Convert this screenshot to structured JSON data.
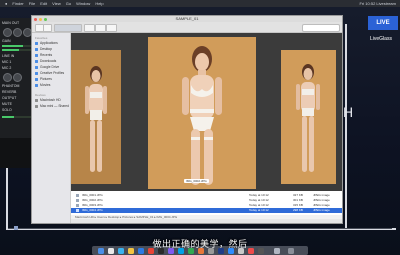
{
  "menubar": {
    "items": [
      "Finder",
      "File",
      "Edit",
      "View",
      "Go",
      "Window",
      "Help"
    ],
    "right_text": "Fri 10:52  Livestream"
  },
  "logo": {
    "text": "LIVE",
    "caption": "LiveGlass"
  },
  "side_glyph": "H",
  "panel": {
    "rows": [
      "MAIN OUT",
      "GAIN",
      "LINE IN",
      "MIC 1",
      "MIC 2",
      "PHANTOM",
      "REVERB",
      "OUTPUT",
      "MUTE",
      "SOLO"
    ]
  },
  "finder": {
    "title": "SAMPLE_01",
    "sidebar": {
      "favorites_label": "Favorites",
      "items": [
        "Applications",
        "Desktop",
        "Recents",
        "Downloads",
        "Google Drive",
        "Creative Profiles",
        "Pictures",
        "Movies"
      ],
      "devices_label": "Devices",
      "devices": [
        "Macintosh HD",
        "Mac mini — Shared"
      ]
    },
    "preview_caption": "IMG_0002.JPG",
    "files": [
      {
        "name": "IMG_0001.JPG",
        "date": "Today at 10:12",
        "size": "327 KB",
        "kind": "JPEG image",
        "selected": false
      },
      {
        "name": "IMG_0002.JPG",
        "date": "Today at 10:12",
        "size": "301 KB",
        "kind": "JPEG image",
        "selected": false
      },
      {
        "name": "IMG_0003.JPG",
        "date": "Today at 10:12",
        "size": "315 KB",
        "kind": "JPEG image",
        "selected": false
      },
      {
        "name": "IMG_0004.JPG",
        "date": "Today at 10:12",
        "size": "298 KB",
        "kind": "JPEG image",
        "selected": true
      }
    ],
    "path": "Macintosh HD ▸ Users ▸ Desktop ▸ Pictures ▸ SAMPLE_01 ▸ IMG_0004.JPG"
  },
  "subtitle": "做出正确的美学，然后",
  "colors": {
    "accent": "#2f6bd8",
    "backdrop": "#d19c5a",
    "desktop": "#0e1320"
  }
}
